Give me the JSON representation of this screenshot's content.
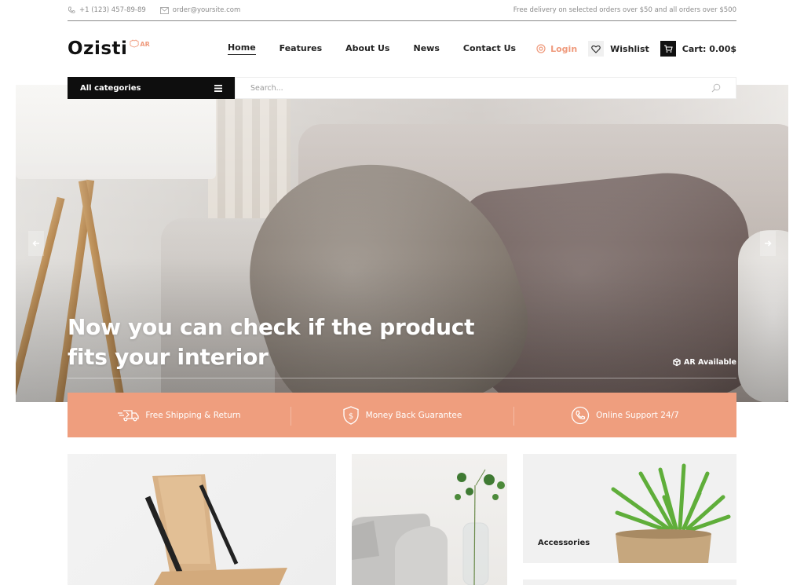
{
  "topbar": {
    "phone": "+1 (123) 457-89-89",
    "email": "order@yoursite.com",
    "promo": "Free delivery on selected orders over $50 and all orders over $500"
  },
  "header": {
    "logo": "Ozisti",
    "logo_badge": "AR",
    "nav": [
      {
        "label": "Home",
        "active": true
      },
      {
        "label": "Features",
        "active": false
      },
      {
        "label": "About Us",
        "active": false
      },
      {
        "label": "News",
        "active": false
      },
      {
        "label": "Contact Us",
        "active": false
      }
    ],
    "login": "Login",
    "wishlist": "Wishlist",
    "cart": "Cart: 0.00$"
  },
  "search": {
    "categories_label": "All categories",
    "placeholder": "Search..."
  },
  "hero": {
    "title_line1": "Now you can check if the product",
    "title_line2": "fits your interior",
    "ar_badge": "AR Available",
    "prev_icon": "arrow-left-icon",
    "next_icon": "arrow-right-icon"
  },
  "features": [
    {
      "icon": "truck-icon",
      "label": "Free Shipping & Return"
    },
    {
      "icon": "shield-dollar-icon",
      "label": "Money Back Guarantee"
    },
    {
      "icon": "phone-icon",
      "label": "Online Support 24/7"
    }
  ],
  "tiles": {
    "accessories_label": "Accessories"
  },
  "colors": {
    "accent": "#ef9e7e",
    "dark": "#0e0e0e"
  }
}
